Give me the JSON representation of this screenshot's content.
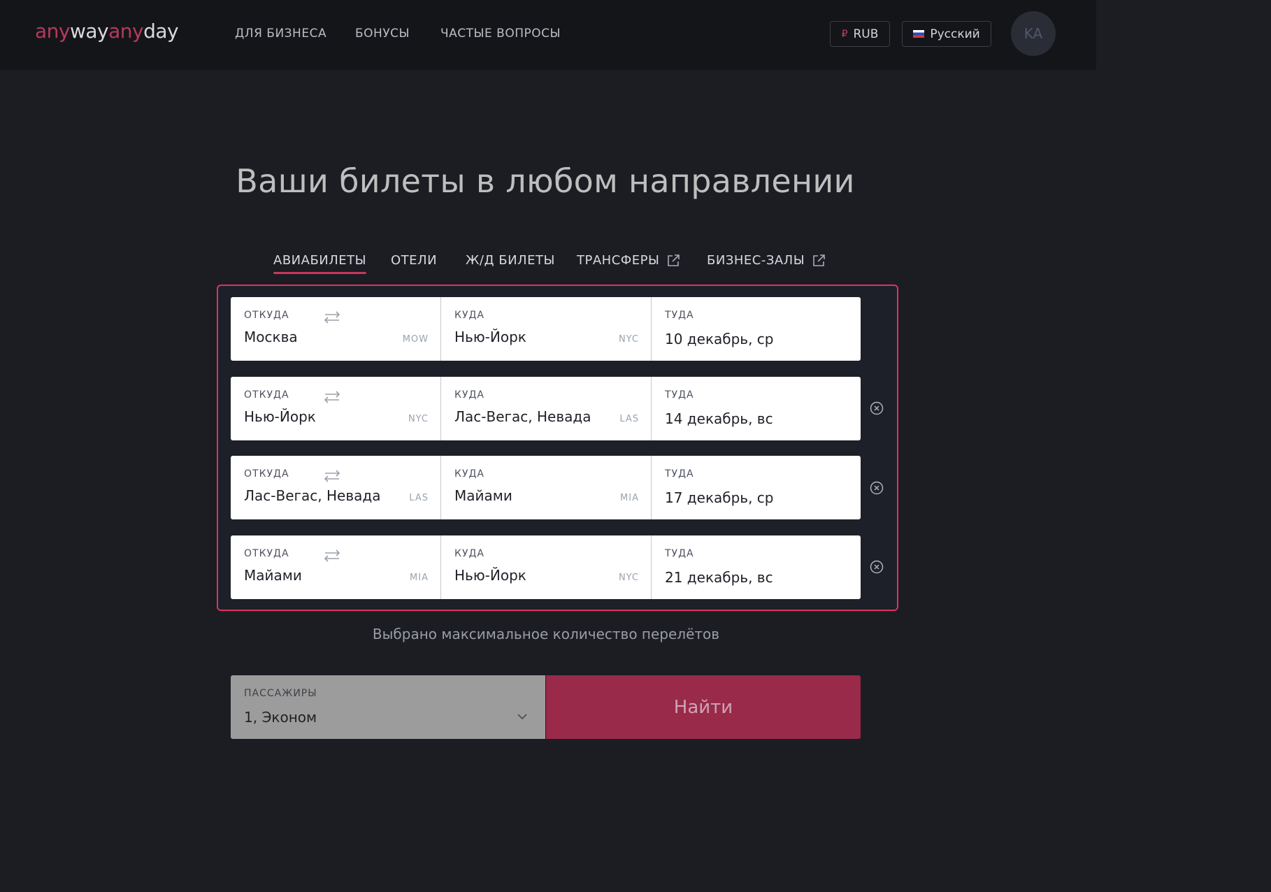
{
  "header": {
    "logo": {
      "part1": "any",
      "part2": "way",
      "part3": "any",
      "part4": "day"
    },
    "nav": [
      "ДЛЯ БИЗНЕСА",
      "БОНУСЫ",
      "ЧАСТЫЕ ВОПРОСЫ"
    ],
    "currency": {
      "symbol": "₽",
      "label": "RUB"
    },
    "language": "Русский",
    "avatar_initials": "KA"
  },
  "hero": {
    "title": "Ваши билеты в любом направлении"
  },
  "tabs": [
    "АВИАБИЛЕТЫ",
    "ОТЕЛИ",
    "Ж/Д БИЛЕТЫ",
    "ТРАНСФЕРЫ",
    "БИЗНЕС-ЗАЛЫ"
  ],
  "active_tab": "АВИАБИЛЕТЫ",
  "labels": {
    "from": "ОТКУДА",
    "to": "КУДА",
    "date": "ТУДА"
  },
  "segments": [
    {
      "from": "Москва",
      "from_code": "MOW",
      "to": "Нью-Йорк",
      "to_code": "NYC",
      "date": "10 декабрь, ср"
    },
    {
      "from": "Нью-Йорк",
      "from_code": "NYC",
      "to": "Лас-Вегас, Невада",
      "to_code": "LAS",
      "date": "14 декабрь, вс"
    },
    {
      "from": "Лас-Вегас, Невада",
      "from_code": "LAS",
      "to": "Майами",
      "to_code": "MIA",
      "date": "17 декабрь, ср"
    },
    {
      "from": "Майами",
      "from_code": "MIA",
      "to": "Нью-Йорк",
      "to_code": "NYC",
      "date": "21 декабрь, вс"
    }
  ],
  "note": "Выбрано максимальное количество перелётов",
  "passengers": {
    "label": "ПАССАЖИРЫ",
    "value": "1, Эконом"
  },
  "search_button": "Найти",
  "colors": {
    "accent": "#e0325e",
    "button": "#992a4a",
    "background": "#1b1d23",
    "header": "#141519"
  }
}
